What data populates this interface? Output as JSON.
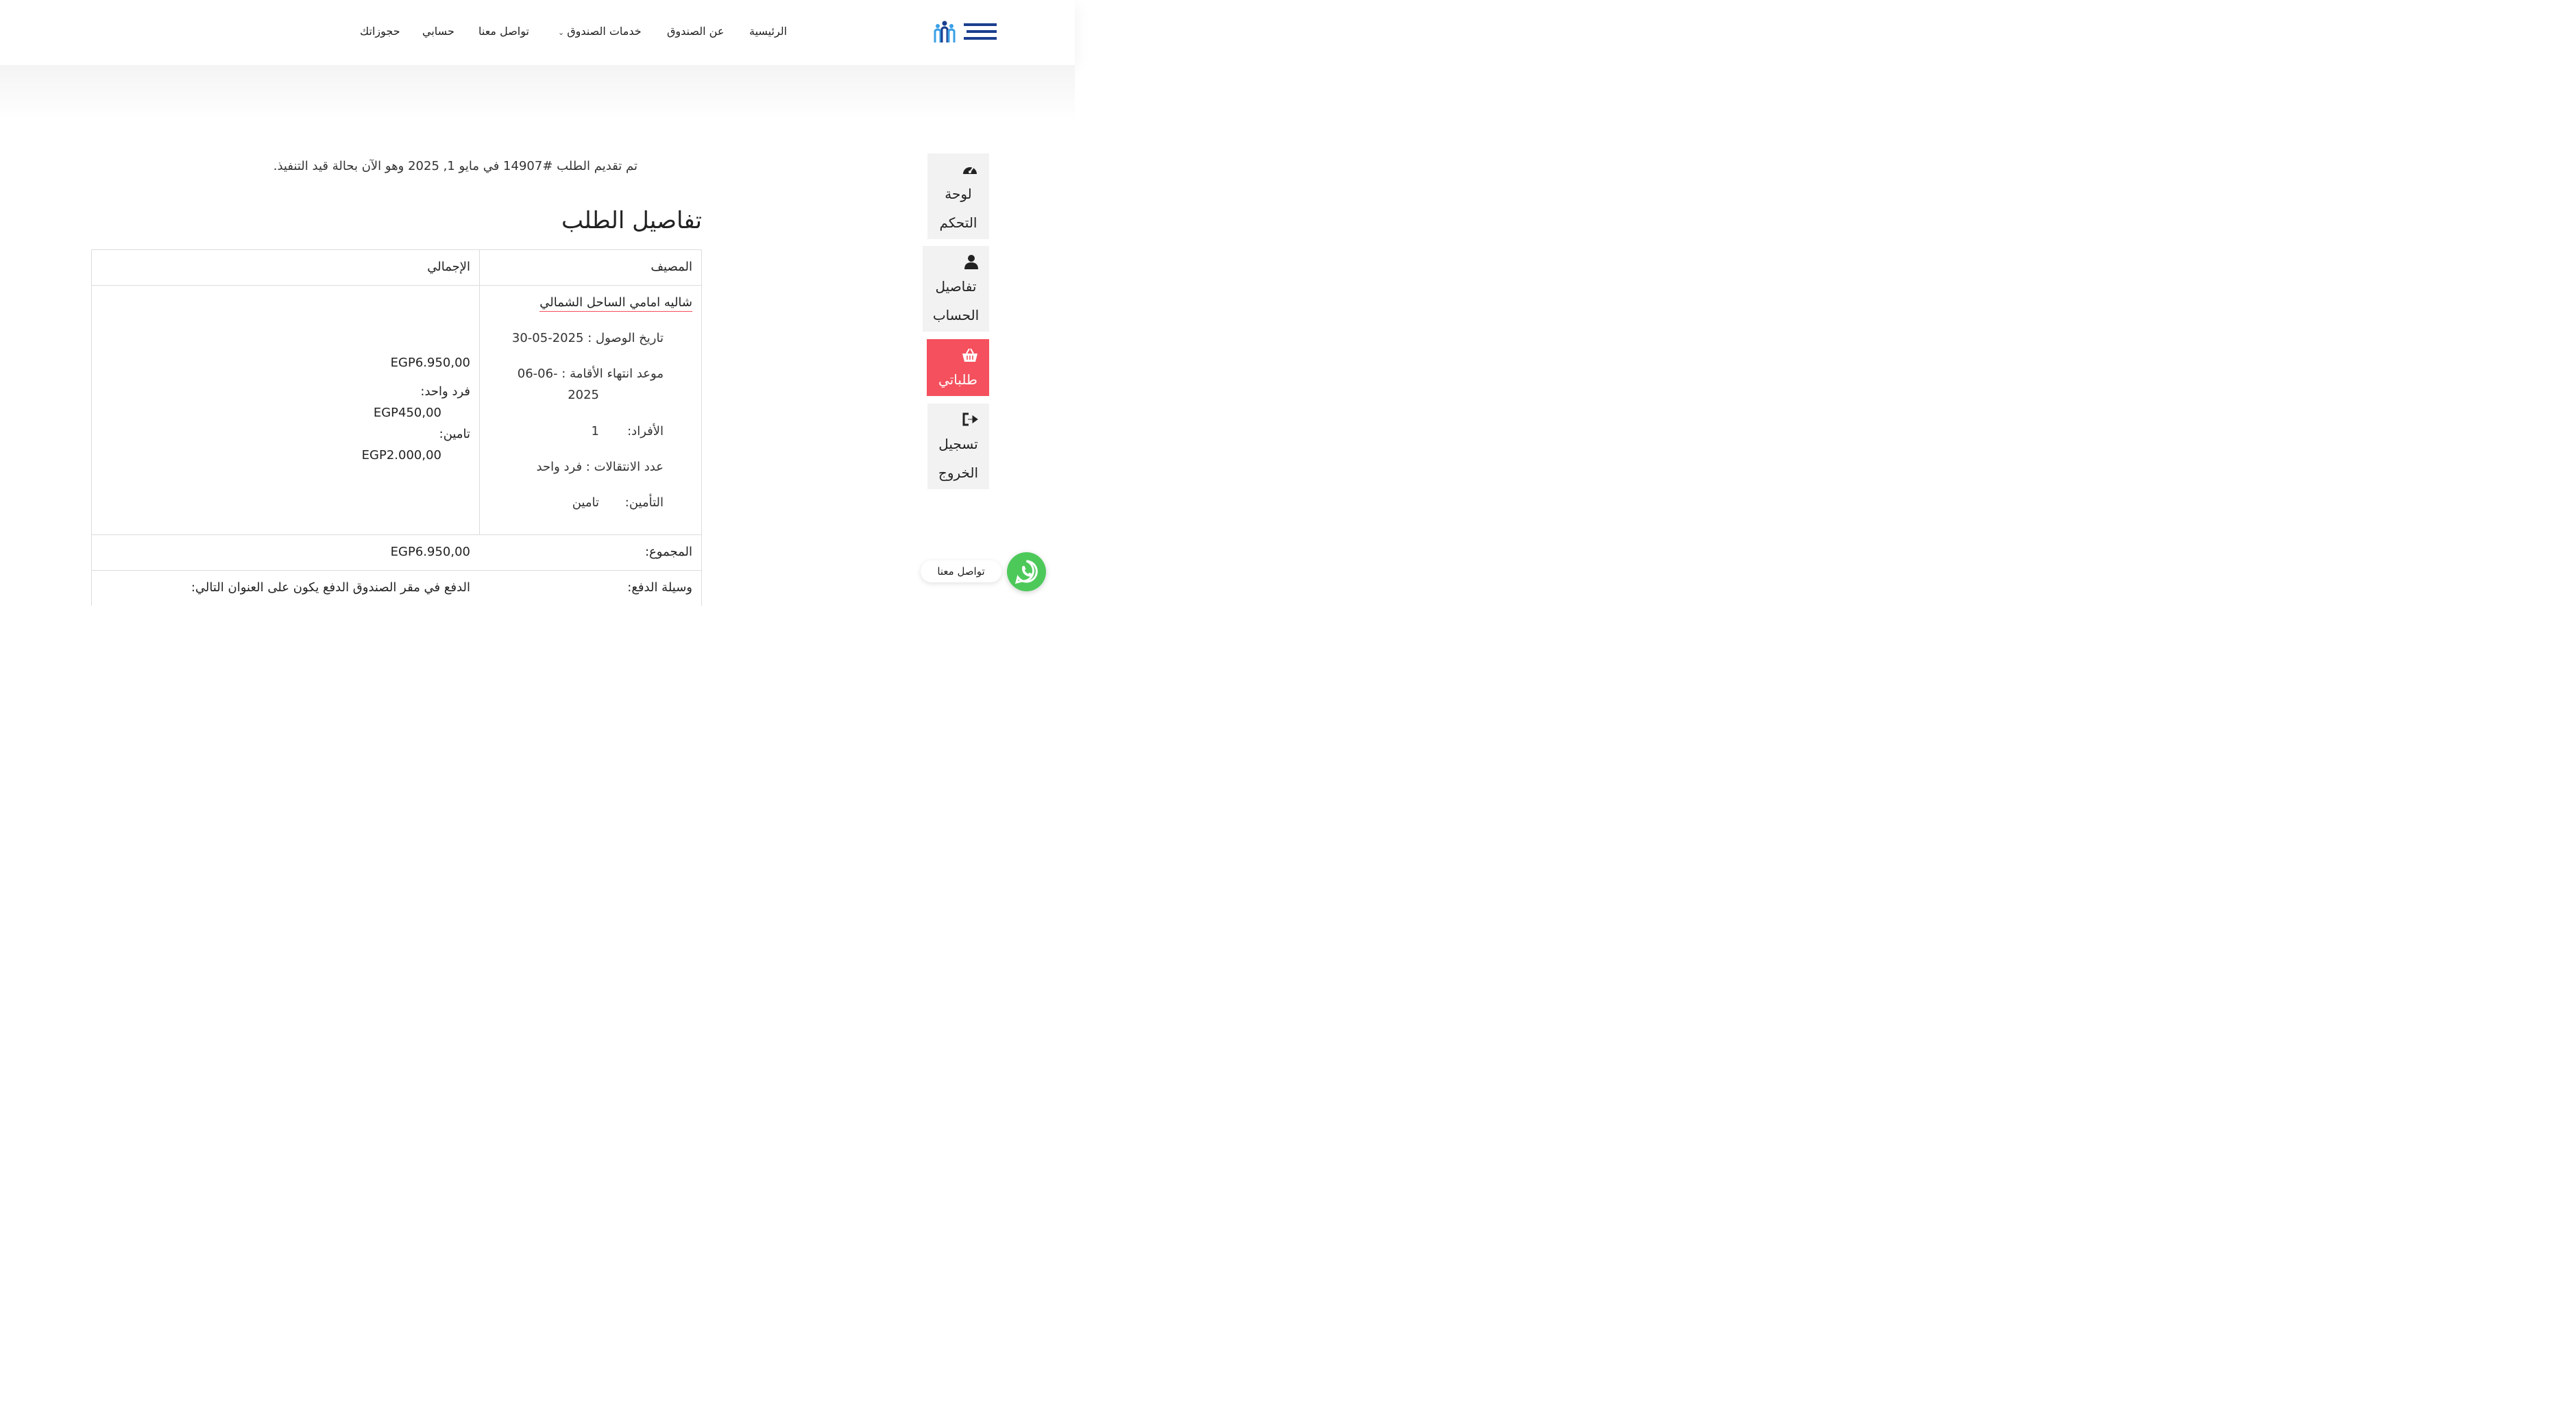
{
  "nav": {
    "home": "الرئيسية",
    "about": "عن الصندوق",
    "services": "خدمات الصندوق",
    "contact": "تواصل معنا",
    "account": "حسابي",
    "bookings": "حجوزاتك"
  },
  "sidebar": {
    "dashboard": [
      "لوحة",
      "التحكم"
    ],
    "account_details": [
      "تفاصيل",
      "الحساب"
    ],
    "orders": "طلباتي",
    "logout": [
      "تسجيل",
      "الخروج"
    ]
  },
  "order": {
    "notice": "تم تقديم الطلب #14907 في مايو 1, 2025 وهو الآن بحالة قيد التنفيذ.",
    "title": "تفاصيل الطلب",
    "col_product": "المصيف",
    "col_total": "الإجمالي",
    "product_name": "شاليه امامي الساحل الشمالي",
    "arrival_label": "تاريخ الوصول : 2025-05-30",
    "end_label": "موعد انتهاء الأقامة : -06-06",
    "end_year": "2025",
    "persons_label": "الأفراد:",
    "persons_value": "1",
    "transfers_label": "عدد الانتقالات : فرد واحد",
    "insurance_label": "التأمين:",
    "insurance_value": "تامين",
    "line_total": "EGP6.950,00",
    "single_person_label": "فرد واحد:",
    "single_person_value": "EGP450,00",
    "insurance_fee_label": "تامين:",
    "insurance_fee_value": "EGP2.000,00",
    "subtotal_label": "المجموع:",
    "subtotal_value": "EGP6.950,00",
    "payment_label": "وسيلة الدفع:",
    "payment_value": "الدفع في مقر الصندوق الدفع يكون على العنوان التالي:"
  },
  "whatsapp": {
    "label": "تواصل معنا"
  },
  "colors": {
    "accent": "#f4505d",
    "whatsapp": "#4dc95a",
    "logo_blue": "#1b3f8f"
  }
}
